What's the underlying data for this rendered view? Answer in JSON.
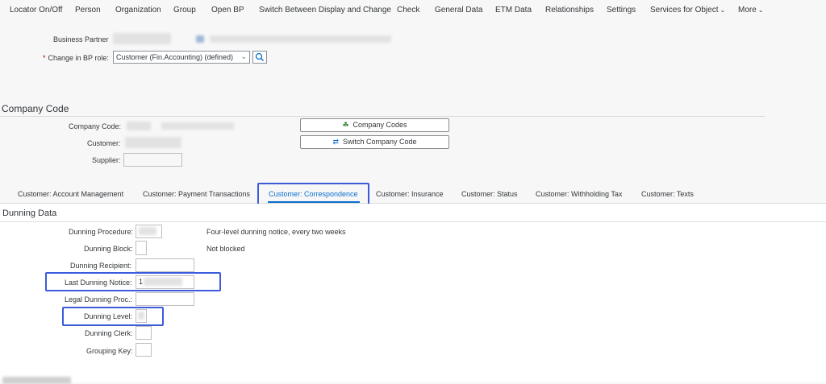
{
  "toolbar": {
    "items": [
      "Locator On/Off",
      "Person",
      "Organization",
      "Group",
      "Open BP",
      "Switch Between Display and Change",
      "Check",
      "General Data",
      "ETM Data",
      "Relationships",
      "Settings",
      "Services for Object",
      "More"
    ]
  },
  "header": {
    "business_partner_label": "Business Partner",
    "change_role_label": "Change in BP role:",
    "role_value": "Customer (Fin.Accounting) (defined)"
  },
  "company_code": {
    "title": "Company Code",
    "company_code_label": "Company Code:",
    "customer_label": "Customer:",
    "supplier_label": "Supplier:",
    "company_codes_button": "Company Codes",
    "switch_company_code_button": "Switch Company Code"
  },
  "tabs": [
    "Customer: Account Management",
    "Customer: Payment Transactions",
    "Customer: Correspondence",
    "Customer: Insurance",
    "Customer: Status",
    "Customer: Withholding Tax",
    "Customer: Texts"
  ],
  "dunning": {
    "title": "Dunning Data",
    "procedure_label": "Dunning Procedure:",
    "procedure_text": "Four-level dunning notice, every two weeks",
    "block_label": "Dunning Block:",
    "block_text": "Not blocked",
    "recipient_label": "Dunning Recipient:",
    "last_notice_label": "Last Dunning Notice:",
    "last_notice_value": "1",
    "legal_label": "Legal Dunning Proc.:",
    "level_label": "Dunning Level:",
    "clerk_label": "Dunning Clerk:",
    "grouping_label": "Grouping Key:"
  },
  "colors": {
    "accent": "#0a6ed1",
    "highlight": "#3b5bdb",
    "required": "#bb0000"
  },
  "icons": {
    "search": "search-icon",
    "company_codes": "company-codes-icon",
    "switch": "switch-icon",
    "chevron": "chevron-down-icon"
  }
}
